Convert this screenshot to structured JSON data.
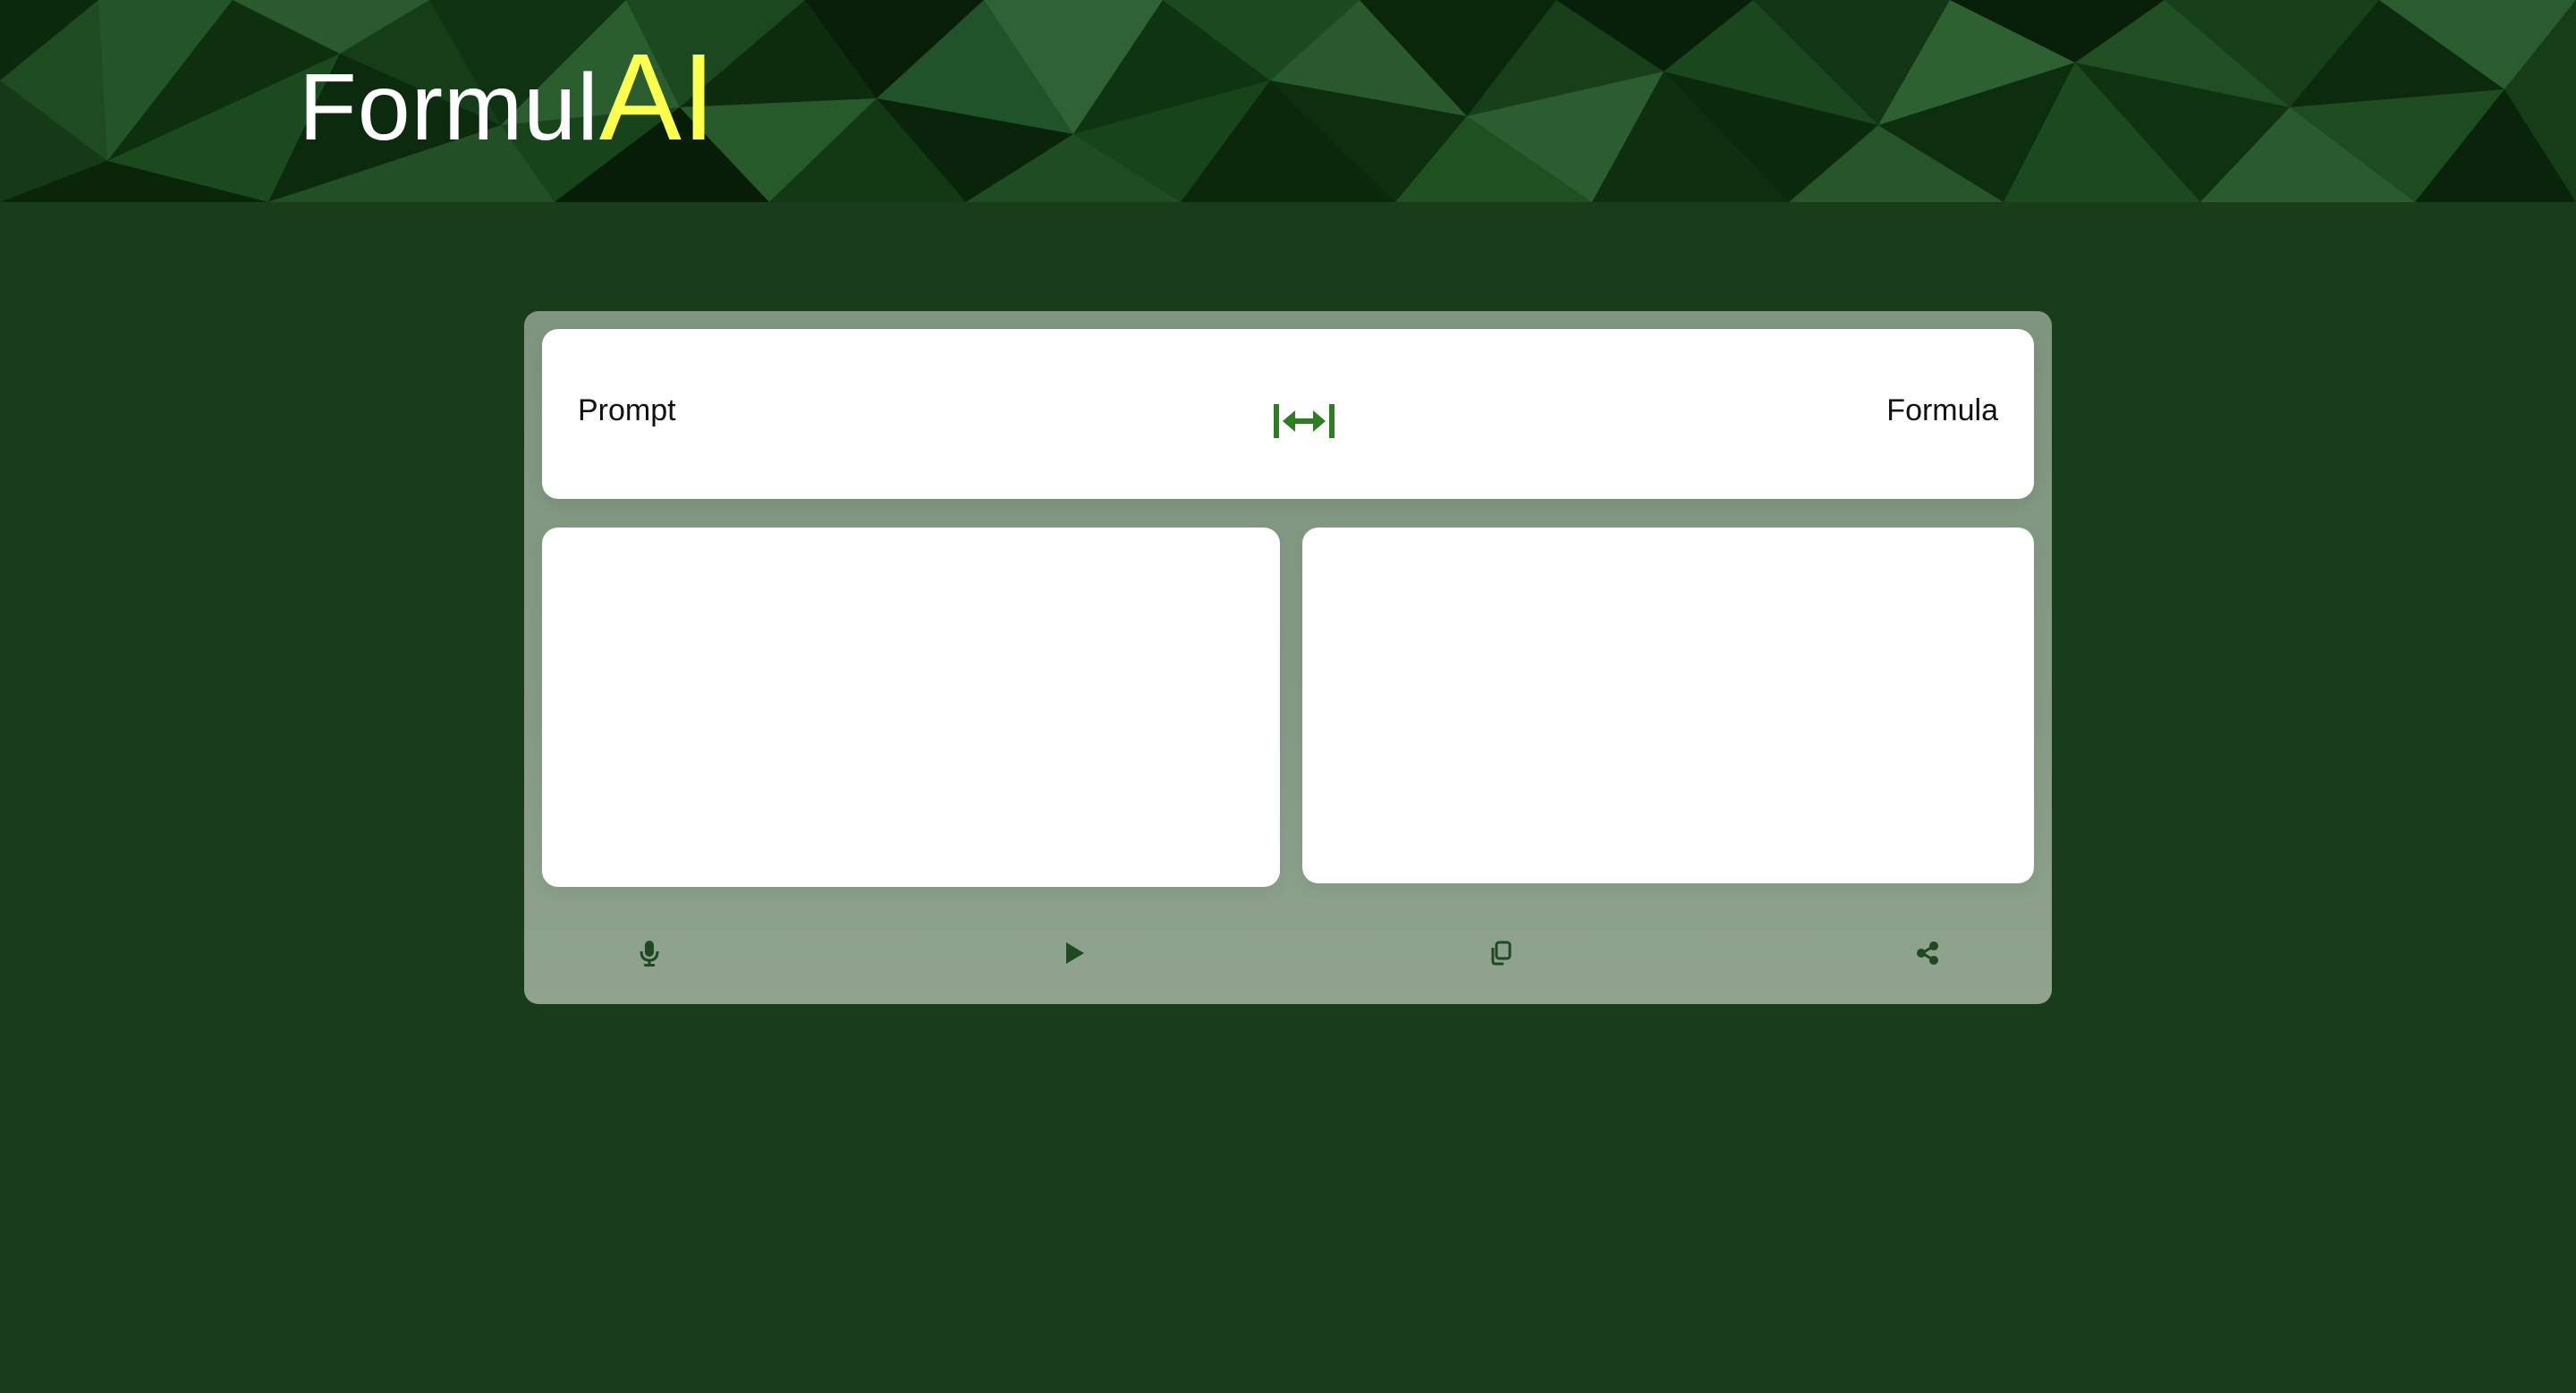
{
  "brand": {
    "name_part1": "Formul",
    "name_part2": "AI",
    "accent_color": "#ffff4d",
    "background_color": "#193d1b"
  },
  "translator": {
    "source_label": "Prompt",
    "target_label": "Formula",
    "swap_icon": "swap-arrows-icon",
    "input_value": "",
    "output_value": ""
  },
  "toolbar": {
    "icons": [
      "microphone-icon",
      "play-icon",
      "copy-icon",
      "share-icon"
    ]
  }
}
